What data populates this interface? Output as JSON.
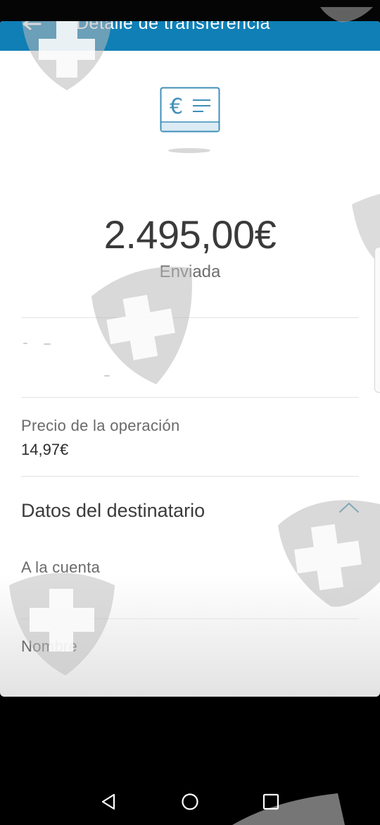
{
  "header": {
    "title": "Detalle de transferencia"
  },
  "transfer": {
    "amount": "2.495,00€",
    "status": "Enviada"
  },
  "fields": {
    "price_label": "Precio de la operación",
    "price_value": "14,97€"
  },
  "recipient": {
    "section_title": "Datos del destinatario",
    "account_label": "A la cuenta",
    "name_label": "Nombre"
  },
  "icons": {
    "back": "back-arrow-icon",
    "receipt": "euro-receipt-icon",
    "collapse": "chevron-up-icon",
    "nav_back": "triangle-back-icon",
    "nav_home": "circle-home-icon",
    "nav_recents": "square-recents-icon"
  },
  "colors": {
    "brand": "#0f7fb6",
    "icon_accent": "#3f8fb8"
  }
}
